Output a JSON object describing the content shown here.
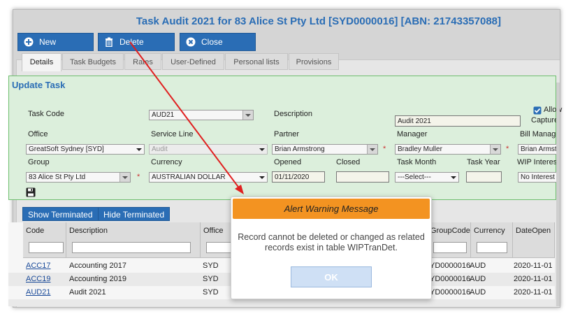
{
  "window": {
    "title": "Task Audit 2021 for 83 Alice St Pty Ltd [SYD0000016] [ABN: 21743357088]"
  },
  "toolbar": {
    "new_label": "New",
    "delete_label": "Delete",
    "close_label": "Close"
  },
  "tabs": [
    "Details",
    "Task Budgets",
    "Rates",
    "User-Defined",
    "Personal lists",
    "Provisions"
  ],
  "form": {
    "title": "Update Task",
    "task_code_label": "Task Code",
    "task_code_value": "AUD21",
    "description_label": "Description",
    "description_value": "Audit 2021",
    "allow_capture_label_1": "Allow",
    "allow_capture_label_2": "Capture",
    "office_label": "Office",
    "office_value": "GreatSoft Sydney [SYD]",
    "service_line_label": "Service Line",
    "service_line_value": "Audit",
    "partner_label": "Partner",
    "partner_value": "Brian Armstrong",
    "manager_label": "Manager",
    "manager_value": "Bradley Muller",
    "bill_manager_label": "Bill Manage",
    "bill_manager_value": "Brian Armstro",
    "group_label": "Group",
    "group_value": "83 Alice St Pty Ltd",
    "currency_label": "Currency",
    "currency_value": "AUSTRALIAN DOLLAR",
    "opened_label": "Opened",
    "opened_value": "01/11/2020",
    "closed_label": "Closed",
    "closed_value": "",
    "task_month_label": "Task Month",
    "task_month_value": "---Select---",
    "task_year_label": "Task Year",
    "task_year_value": "",
    "wip_interest_label": "WIP Interest",
    "wip_interest_value": "No Interest",
    "required_mark": "*"
  },
  "grid_buttons": {
    "show_terminated": "Show Terminated",
    "hide_terminated": "Hide Terminated"
  },
  "grid": {
    "headers": {
      "code": "Code",
      "description": "Description",
      "office": "Office",
      "group_code": "GroupCode",
      "currency": "Currency",
      "date_open": "DateOpen"
    },
    "rows": [
      {
        "code": "ACC17",
        "description": "Accounting 2017",
        "office": "SYD",
        "group_code": "YD0000016",
        "currency": "AUD",
        "date_open": "2020-11-01"
      },
      {
        "code": "ACC19",
        "description": "Accounting 2019",
        "office": "SYD",
        "group_code": "YD0000016",
        "currency": "AUD",
        "date_open": "2020-11-01"
      },
      {
        "code": "AUD21",
        "description": "Audit 2021",
        "office": "SYD",
        "group_code": "YD0000016",
        "currency": "AUD",
        "date_open": "2020-11-01"
      }
    ]
  },
  "dialog": {
    "title": "Alert Warning Message",
    "message_line1": "Record cannot be deleted or changed as related",
    "message_line2": "records exist in table WIPTranDet.",
    "ok_label": "OK"
  },
  "colors": {
    "accent": "#2a6db5",
    "form_bg": "#dcefdc",
    "form_border": "#6fbf6f",
    "dialog_header": "#f39321",
    "annotation_arrow": "#e02020"
  },
  "icons": {
    "new": "plus-circle-icon",
    "delete": "trash-icon",
    "close": "x-circle-icon",
    "save": "floppy-disk-icon",
    "allow_capture": "checkbox-checked-icon"
  }
}
